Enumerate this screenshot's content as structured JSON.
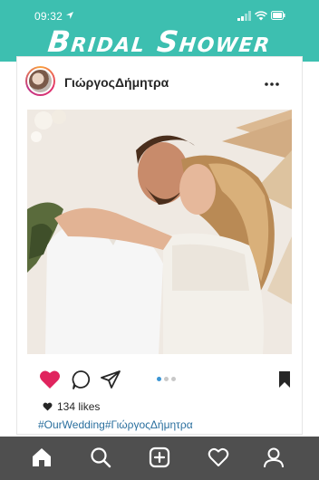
{
  "status_bar": {
    "time": "09:32"
  },
  "banner": {
    "title": "Bridal Shower"
  },
  "post": {
    "username": "ΓιώργοςΔήμητρα",
    "likes": "134 likes",
    "hashtags": "#OurWedding#ΓιώργοςΔήμητρα",
    "carousel": {
      "count": 3,
      "active": 1
    }
  },
  "colors": {
    "banner": "#3dbfb0",
    "like_red": "#e0245e",
    "hashtag": "#2a6f9e",
    "nav_bg": "#4f4f4f"
  },
  "icons": {
    "post_actions": [
      "heart-icon",
      "comment-icon",
      "share-icon",
      "bookmark-icon"
    ],
    "bottom_nav": [
      "home-icon",
      "search-icon",
      "add-post-icon",
      "activity-heart-icon",
      "profile-icon"
    ]
  }
}
